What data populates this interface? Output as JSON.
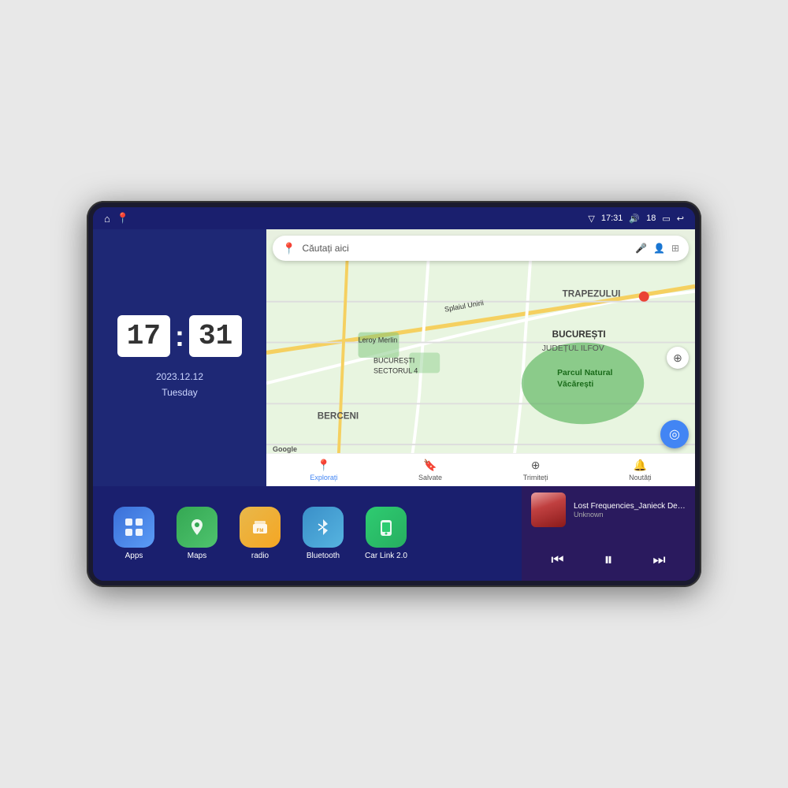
{
  "device": {
    "status_bar": {
      "left_icons": [
        "home",
        "maps-pin"
      ],
      "time": "17:31",
      "signal_icon": "signal",
      "volume_icon": "volume",
      "volume_level": "18",
      "battery_icon": "battery",
      "back_icon": "back"
    },
    "clock": {
      "hour": "17",
      "minute": "31",
      "date": "2023.12.12",
      "day": "Tuesday"
    },
    "map": {
      "search_placeholder": "Căutați aici",
      "labels": [
        "TRAPEZULUI",
        "BUCUREȘTI",
        "JUDEȚUL ILFOV",
        "BERCENI",
        "Parcul Natural Văcărești",
        "Leroy Merlin",
        "BUCUREȘTI\nSECTORUL 4",
        "Splaiul Unirii"
      ],
      "nav_items": [
        {
          "label": "Explorați",
          "active": true
        },
        {
          "label": "Salvate",
          "active": false
        },
        {
          "label": "Trimiteți",
          "active": false
        },
        {
          "label": "Noutăți",
          "active": false
        }
      ]
    },
    "apps": [
      {
        "label": "Apps",
        "icon_class": "icon-apps",
        "icon": "⊞"
      },
      {
        "label": "Maps",
        "icon_class": "icon-maps",
        "icon": "📍"
      },
      {
        "label": "radio",
        "icon_class": "icon-radio",
        "icon": "📻"
      },
      {
        "label": "Bluetooth",
        "icon_class": "icon-bluetooth",
        "icon": "☊"
      },
      {
        "label": "Car Link 2.0",
        "icon_class": "icon-carlink",
        "icon": "📱"
      }
    ],
    "music": {
      "title": "Lost Frequencies_Janieck Devy-...",
      "artist": "Unknown",
      "controls": {
        "prev": "⏮",
        "play": "⏸",
        "next": "⏭"
      }
    }
  }
}
